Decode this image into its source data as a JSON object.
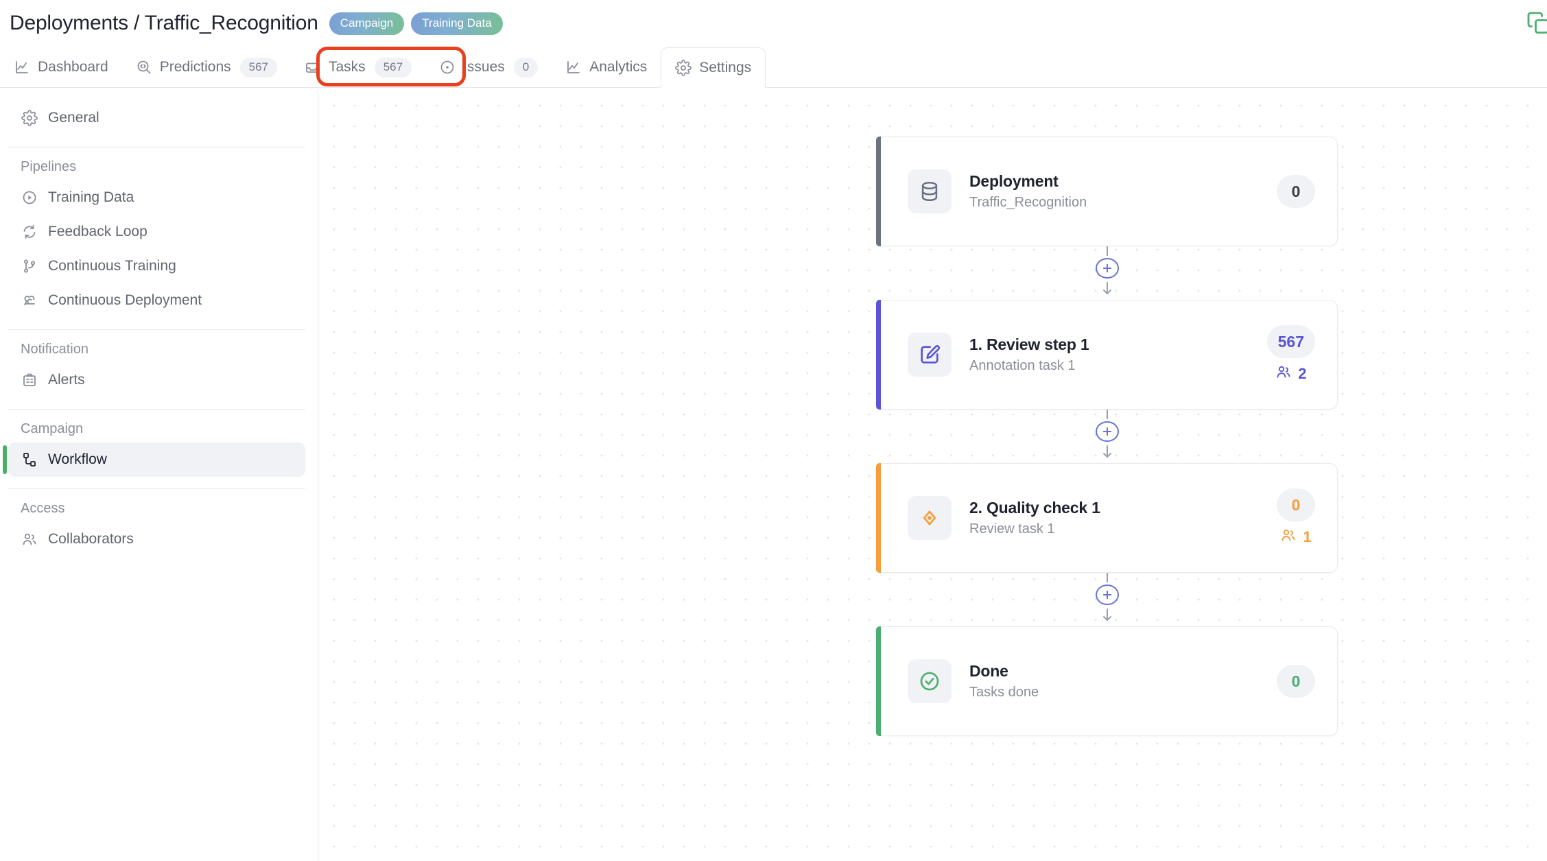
{
  "header": {
    "title": "Deployments / Traffic_Recognition",
    "badges": [
      {
        "label": "Campaign"
      },
      {
        "label": "Training Data"
      }
    ],
    "copy_icon": "copy-icon",
    "accent_gradient_from": "#7b9fd4",
    "accent_gradient_to": "#79bf96"
  },
  "tabs": [
    {
      "id": "dashboard",
      "label": "Dashboard",
      "icon": "chart-line-icon",
      "count": null,
      "active": false
    },
    {
      "id": "predictions",
      "label": "Predictions",
      "icon": "code-search-icon",
      "count": "567",
      "active": false
    },
    {
      "id": "tasks",
      "label": "Tasks",
      "icon": "inbox-icon",
      "count": "567",
      "active": false
    },
    {
      "id": "issues",
      "label": "Issues",
      "icon": "target-dot-icon",
      "count": "0",
      "active": false
    },
    {
      "id": "analytics",
      "label": "Analytics",
      "icon": "chart-line-icon",
      "count": null,
      "active": false
    },
    {
      "id": "settings",
      "label": "Settings",
      "icon": "gear-icon",
      "count": null,
      "active": true
    }
  ],
  "annotation": {
    "color": "#e8401f",
    "highlights": [
      "tasks",
      "issues"
    ]
  },
  "sidebar": {
    "top_items": [
      {
        "id": "general",
        "label": "General",
        "icon": "gear-icon",
        "selected": false
      }
    ],
    "groups": [
      {
        "title": "Pipelines",
        "items": [
          {
            "id": "training-data",
            "label": "Training Data",
            "icon": "play-circle-icon",
            "selected": false
          },
          {
            "id": "feedback-loop",
            "label": "Feedback Loop",
            "icon": "refresh-icon",
            "selected": false
          },
          {
            "id": "continuous-training",
            "label": "Continuous Training",
            "icon": "git-branch-icon",
            "selected": false
          },
          {
            "id": "continuous-deployment",
            "label": "Continuous Deployment",
            "icon": "webhook-icon",
            "selected": false
          }
        ]
      },
      {
        "title": "Notification",
        "items": [
          {
            "id": "alerts",
            "label": "Alerts",
            "icon": "alert-board-icon",
            "selected": false
          }
        ]
      },
      {
        "title": "Campaign",
        "items": [
          {
            "id": "workflow",
            "label": "Workflow",
            "icon": "workflow-icon",
            "selected": true
          }
        ]
      },
      {
        "title": "Access",
        "items": [
          {
            "id": "collaborators",
            "label": "Collaborators",
            "icon": "users-icon",
            "selected": false
          }
        ]
      }
    ],
    "selected_indicator_color": "#48b06a"
  },
  "workflow": {
    "nodes": [
      {
        "id": "deployment",
        "title": "Deployment",
        "subtitle": "Traffic_Recognition",
        "icon": "database-icon",
        "count": "0",
        "assignees": null,
        "accent": "#6b7280",
        "count_color": "#3b3e47",
        "icon_color": "#6b7280"
      },
      {
        "id": "review-step-1",
        "title": "1. Review step 1",
        "subtitle": "Annotation task 1",
        "icon": "edit-square-icon",
        "count": "567",
        "assignees": "2",
        "accent": "#5b55d6",
        "count_color": "#5b55d6",
        "icon_color": "#5b55d6"
      },
      {
        "id": "quality-check-1",
        "title": "2. Quality check 1",
        "subtitle": "Review task 1",
        "icon": "eye-diamond-icon",
        "count": "0",
        "assignees": "1",
        "accent": "#f59e3b",
        "count_color": "#f59e3b",
        "icon_color": "#f59e3b"
      },
      {
        "id": "done",
        "title": "Done",
        "subtitle": "Tasks done",
        "icon": "check-circle-icon",
        "count": "0",
        "assignees": null,
        "accent": "#4caf72",
        "count_color": "#4caf72",
        "icon_color": "#4caf72"
      }
    ],
    "connector": {
      "icon": "plus-circle-icon",
      "color": "#6574d8"
    }
  }
}
